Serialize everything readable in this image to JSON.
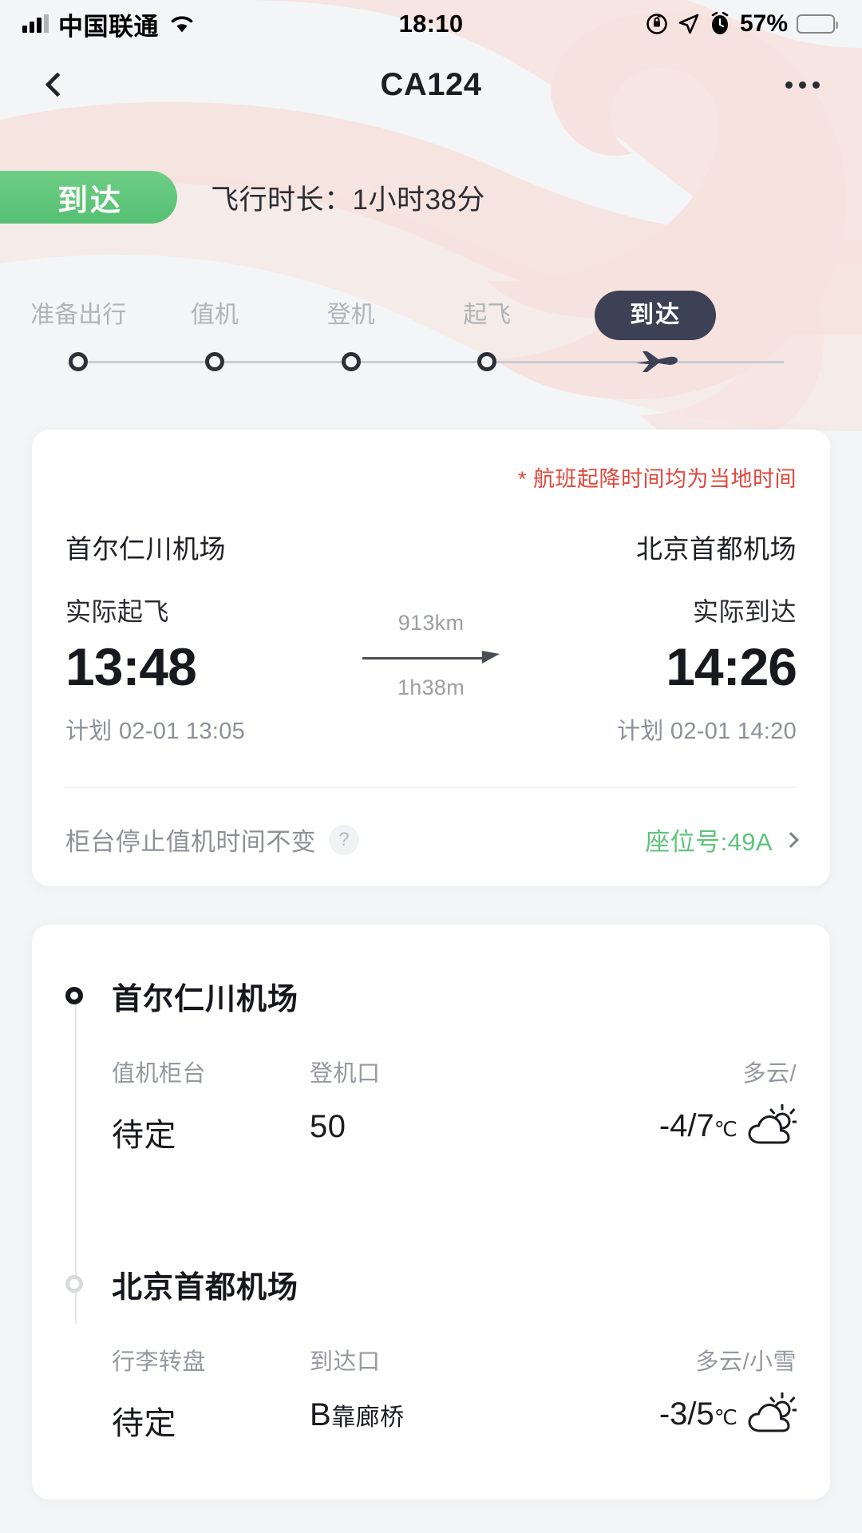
{
  "statusbar": {
    "carrier": "中国联通",
    "time": "18:10",
    "battery_percent": "57%",
    "icons": [
      "signal-bars-icon",
      "wifi-icon",
      "rotation-lock-icon",
      "location-arrow-icon",
      "alarm-clock-icon",
      "battery-icon"
    ]
  },
  "header": {
    "title": "CA124",
    "back_icon": "chevron-left-icon",
    "more_icon": "more-horizontal-icon"
  },
  "summary": {
    "status_badge": "到达",
    "duration": "飞行时长：1小时38分",
    "badge_color": "#5cc377"
  },
  "progress": {
    "steps": [
      {
        "label": "准备出行",
        "active": false
      },
      {
        "label": "值机",
        "active": false
      },
      {
        "label": "登机",
        "active": false
      },
      {
        "label": "起飞",
        "active": false
      },
      {
        "label": "到达",
        "active": true
      }
    ],
    "active_color": "#3d4155",
    "end_icon": "airplane-icon"
  },
  "flight_card": {
    "local_time_note": "* 航班起降时间均为当地时间",
    "note_color": "#e0483c",
    "departure": {
      "airport": "首尔仁川机场",
      "actual_label": "实际起飞",
      "actual_time": "13:48",
      "planned": "计划 02-01 13:05"
    },
    "arrival": {
      "airport": "北京首都机场",
      "actual_label": "实际到达",
      "actual_time": "14:26",
      "planned": "计划 02-01 14:20"
    },
    "middle": {
      "distance": "913km",
      "duration": "1h38m",
      "arrow_icon": "arrow-right-icon"
    },
    "counter_note": "柜台停止值机时间不变",
    "help_icon": "?",
    "seat": "座位号:49A",
    "seat_color": "#5ec47c",
    "seat_chevron_icon": "chevron-right-icon"
  },
  "airport_details": [
    {
      "name": "首尔仁川机场",
      "bullet": "active",
      "fields": [
        {
          "label": "值机柜台",
          "value": "待定"
        },
        {
          "label": "登机口",
          "value": "50"
        }
      ],
      "weather": {
        "label": "多云/",
        "temp": "-4/7",
        "unit": "℃",
        "icon": "sun-behind-cloud-icon"
      }
    },
    {
      "name": "北京首都机场",
      "bullet": "pending",
      "fields": [
        {
          "label": "行李转盘",
          "value": "待定"
        },
        {
          "label": "到达口",
          "value": "B",
          "value_suffix": "靠廊桥"
        }
      ],
      "weather": {
        "label": "多云/小雪",
        "temp": "-3/5",
        "unit": "℃",
        "icon": "sun-behind-cloud-icon"
      }
    }
  ]
}
